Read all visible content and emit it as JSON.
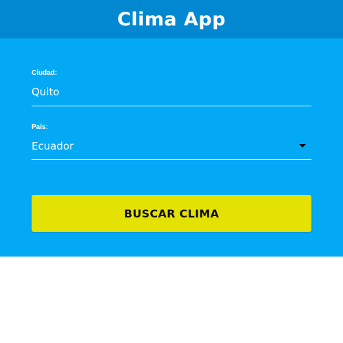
{
  "header": {
    "title": "Clima App",
    "background_color": "#0288d1"
  },
  "form": {
    "background_color": "#03a9f4",
    "city": {
      "label": "Ciudad:",
      "value": "Quito"
    },
    "country": {
      "label": "País:",
      "selected": "Ecuador",
      "icon": "dropdown-arrow-icon"
    },
    "submit": {
      "label": "BUSCAR CLIMA",
      "color": "#e4e105"
    }
  }
}
